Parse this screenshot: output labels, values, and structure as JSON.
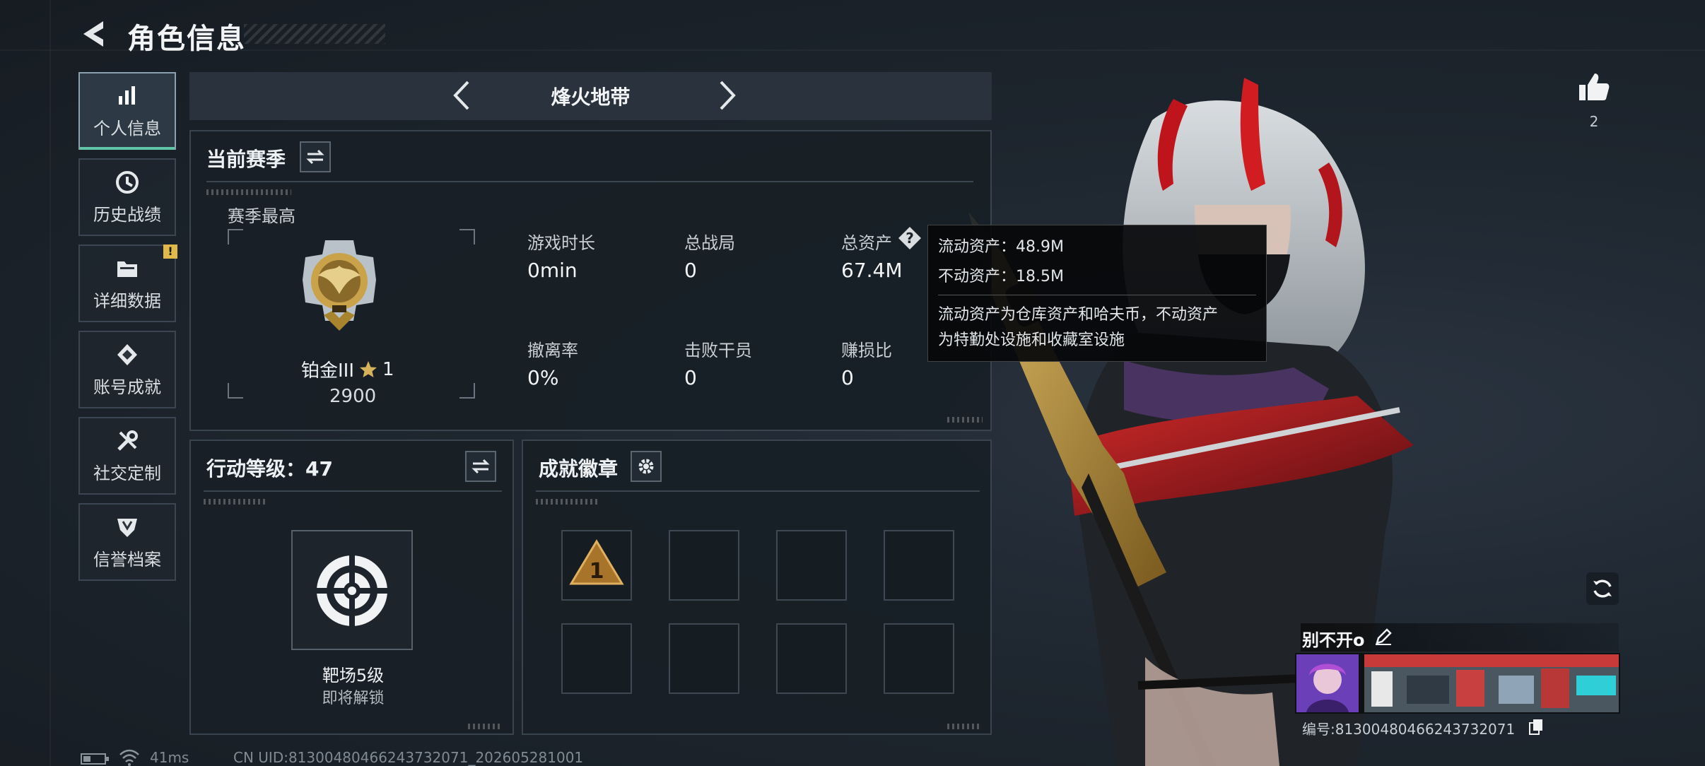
{
  "header": {
    "title": "角色信息"
  },
  "sidebar": {
    "items": [
      {
        "label": "个人信息",
        "icon": "bar-chart-icon",
        "active": true
      },
      {
        "label": "历史战绩",
        "icon": "history-clock-icon"
      },
      {
        "label": "详细数据",
        "icon": "folder-icon",
        "badge": "!"
      },
      {
        "label": "账号成就",
        "icon": "achievement-diamond-icon"
      },
      {
        "label": "社交定制",
        "icon": "tools-icon"
      },
      {
        "label": "信誉档案",
        "icon": "reputation-shield-icon"
      }
    ]
  },
  "mode": {
    "title": "烽火地带"
  },
  "season": {
    "title": "当前赛季",
    "best_label": "赛季最高",
    "rank_name": "铂金III",
    "rank_stars": "1",
    "rank_score": "2900",
    "stats": [
      {
        "label": "游戏时长",
        "value": "0min"
      },
      {
        "label": "总战局",
        "value": "0"
      },
      {
        "label": "总资产",
        "value": "67.4M"
      },
      {
        "label": "撤离率",
        "value": "0%"
      },
      {
        "label": "击败干员",
        "value": "0"
      },
      {
        "label": "赚损比",
        "value": "0"
      }
    ]
  },
  "tooltip": {
    "liquid": "流动资产：48.9M",
    "fixed": "不动资产：18.5M",
    "desc_line1": "流动资产为仓库资产和哈夫币，不动资产",
    "desc_line2": "为特勤处设施和收藏室设施"
  },
  "action_level": {
    "title": "行动等级：47",
    "unlock_name": "靶场5级",
    "unlock_status": "即将解锁"
  },
  "achievements": {
    "title": "成就徽章",
    "first_badge": "1"
  },
  "likes": {
    "count": "2"
  },
  "player": {
    "name": "别不开o",
    "id": "编号:8130048046624373207​1"
  },
  "footer": {
    "ping": "41ms",
    "uid": "CN UID:8130048046624373207​1_202605281001"
  },
  "colors": {
    "accent": "#5fc7a8",
    "badge": "#e0b94a",
    "gold": "#c9a24a"
  }
}
